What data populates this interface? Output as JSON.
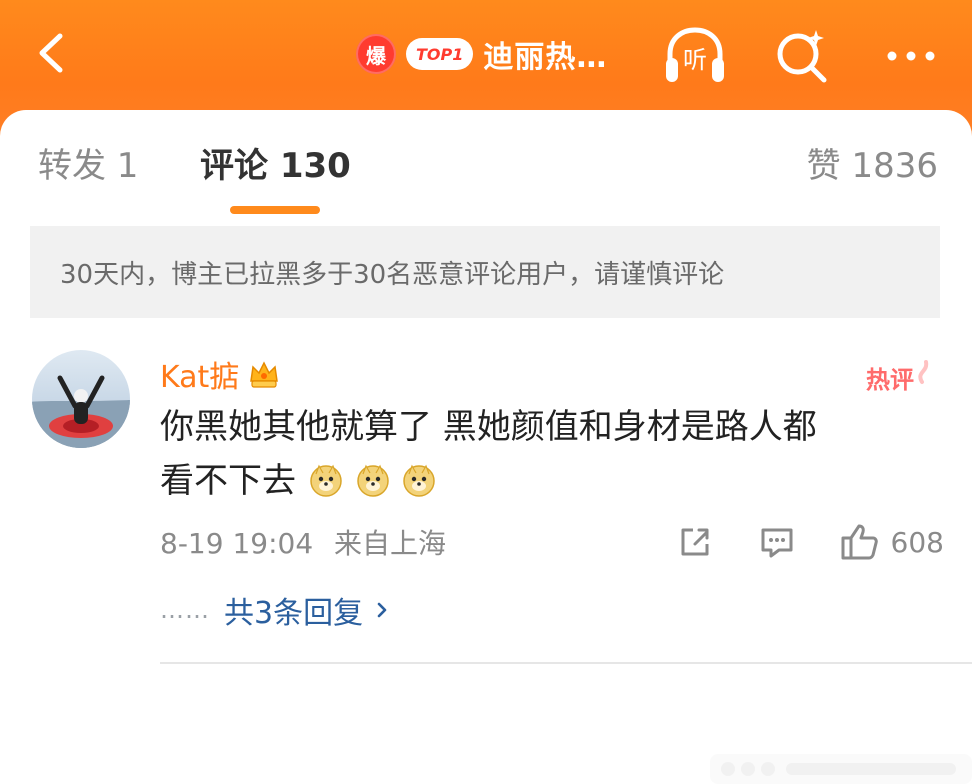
{
  "header": {
    "hot_badge": "爆",
    "rank_badge": "TOP1",
    "title": "迪丽热…",
    "listen_label": "听",
    "colors": {
      "bar_gradient_top": "#ff8a1c",
      "bar_gradient_bottom": "#ff7f26"
    }
  },
  "tabs": {
    "repost": "转发 1",
    "comments": "评论 130",
    "likes": "赞 1836"
  },
  "notice": {
    "text": "30天内，博主已拉黑多于30名恶意评论用户，请谨慎评论"
  },
  "comment": {
    "username": "Kat掂",
    "hot_label": "热评",
    "text_line1": "你黑她其他就算了  黑她颜值和身材是路人都",
    "text_line2": "看不下去",
    "emojis": [
      "doge",
      "doge",
      "doge"
    ],
    "timestamp": "8-19 19:04",
    "location": "来自上海",
    "likes": "608",
    "reply_summary": "共3条回复",
    "reply_dots": "……"
  },
  "icons": {
    "back": "chevron-left-icon",
    "listen": "headphones-icon",
    "search": "search-sparkle-icon",
    "more": "more-dots-icon",
    "share": "share-icon",
    "reply": "comment-icon",
    "like": "thumbs-up-icon"
  }
}
